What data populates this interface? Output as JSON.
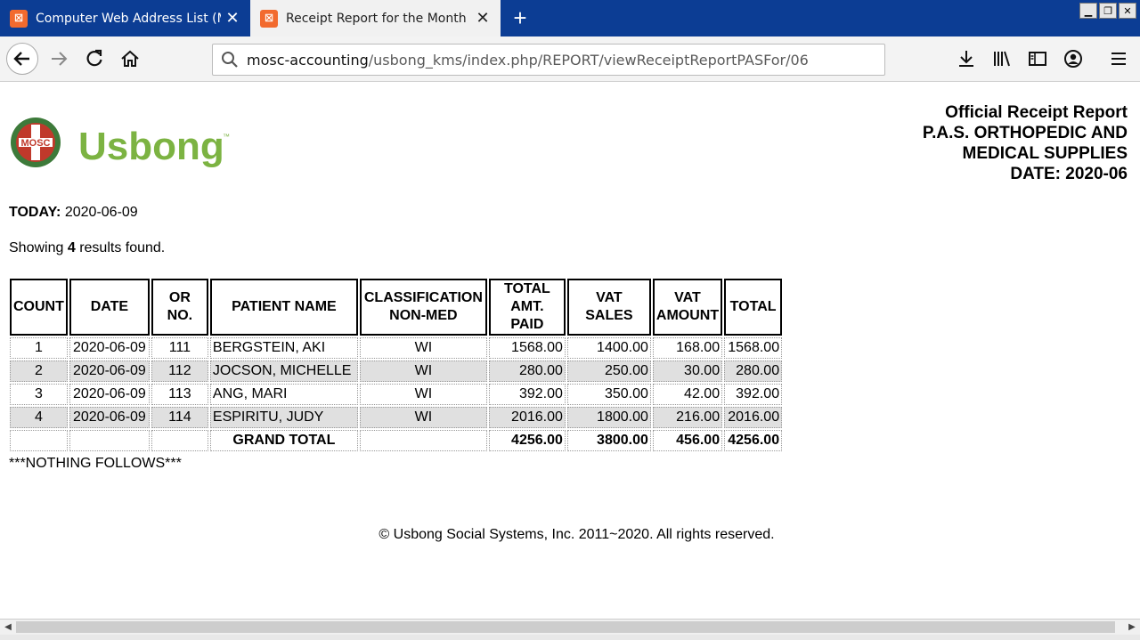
{
  "browser": {
    "tabs": [
      {
        "label": "Computer Web Address List (MOSC",
        "favicon": "xampp-icon"
      },
      {
        "label": "Receipt Report for the Month (PAS",
        "favicon": "xampp-icon"
      }
    ],
    "url_host": "mosc-accounting",
    "url_path": "/usbong_kms/index.php/REPORT/viewReceiptReportPASFor/06"
  },
  "logo": {
    "badge_text": "MOSC",
    "brand": "Usbong",
    "tm": "™"
  },
  "report_header": {
    "line1": "Official Receipt Report",
    "line2": "P.A.S. ORTHOPEDIC AND",
    "line3": "MEDICAL SUPPLIES",
    "line4": "DATE: 2020-06"
  },
  "today": {
    "label": "TODAY:",
    "value": "2020-06-09"
  },
  "showing": {
    "prefix": "Showing",
    "count": "4",
    "suffix": "results found."
  },
  "table": {
    "headers": [
      "COUNT",
      "DATE",
      "OR NO.",
      "PATIENT NAME",
      "CLASSIFICATION NON-MED",
      "TOTAL AMT. PAID",
      "VAT SALES",
      "VAT AMOUNT",
      "TOTAL"
    ],
    "rows": [
      {
        "count": "1",
        "date": "2020-06-09",
        "or_no": "111",
        "patient": "BERGSTEIN, AKI",
        "classification": "WI",
        "amt_paid": "1568.00",
        "vat_sales": "1400.00",
        "vat_amount": "168.00",
        "total": "1568.00"
      },
      {
        "count": "2",
        "date": "2020-06-09",
        "or_no": "112",
        "patient": "JOCSON, MICHELLE",
        "classification": "WI",
        "amt_paid": "280.00",
        "vat_sales": "250.00",
        "vat_amount": "30.00",
        "total": "280.00"
      },
      {
        "count": "3",
        "date": "2020-06-09",
        "or_no": "113",
        "patient": "ANG, MARI",
        "classification": "WI",
        "amt_paid": "392.00",
        "vat_sales": "350.00",
        "vat_amount": "42.00",
        "total": "392.00"
      },
      {
        "count": "4",
        "date": "2020-06-09",
        "or_no": "114",
        "patient": "ESPIRITU, JUDY",
        "classification": "WI",
        "amt_paid": "2016.00",
        "vat_sales": "1800.00",
        "vat_amount": "216.00",
        "total": "2016.00"
      }
    ],
    "grand_total": {
      "label": "GRAND TOTAL",
      "amt_paid": "4256.00",
      "vat_sales": "3800.00",
      "vat_amount": "456.00",
      "total": "4256.00"
    }
  },
  "nothing_follows": "***NOTHING FOLLOWS***",
  "footer": "© Usbong Social Systems, Inc. 2011~2020. All rights reserved.",
  "colors": {
    "tabstrip": "#0c3d94",
    "brand_green": "#7cb342",
    "badge_red": "#c0392b",
    "row_shade": "#e0e0e0"
  }
}
